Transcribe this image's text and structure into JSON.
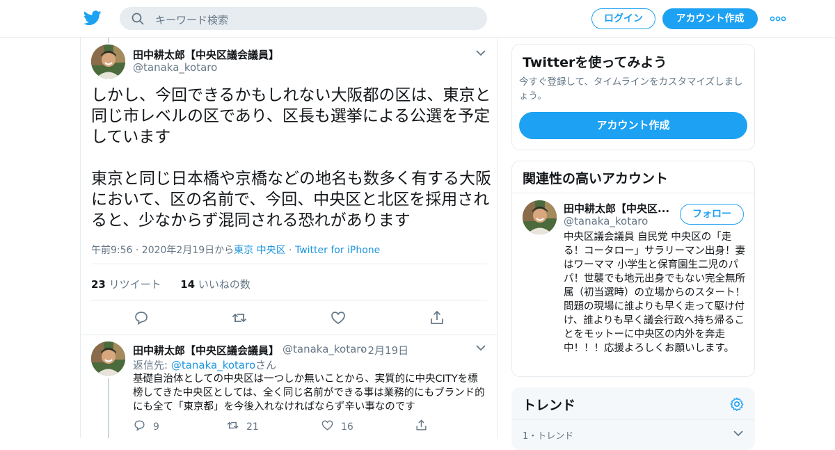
{
  "header": {
    "search_placeholder": "キーワード検索",
    "login_label": "ログイン",
    "signup_label": "アカウント作成",
    "brand_color": "#1da1f2"
  },
  "main_tweet": {
    "author_name": "田中耕太郎【中央区議会議員】",
    "author_handle": "@tanaka_kotaro",
    "text": "しかし、今回できるかもしれない大阪都の区は、東京と同じ市レベルの区であり、区長も選挙による公選を予定しています\n\n東京と同じ日本橋や京橋などの地名も数多く有する大阪において、区の名前で、今回、中央区と北区を採用されると、少なからず混同される恐れがあります",
    "time_date": "午前9:56 · 2020年2月19日から",
    "location": "東京 中央区",
    "meta_sep": " · ",
    "source": "Twitter for iPhone",
    "retweet_count": "23",
    "retweet_label": "リツイート",
    "like_count": "14",
    "like_label": "いいねの数"
  },
  "reply_tweet": {
    "author_name": "田中耕太郎【中央区議会議員】",
    "author_handle": "@tanaka_kotaro",
    "date": "· 2月19日",
    "reply_to_prefix": "返信先: ",
    "reply_to_handle": "@tanaka_kotaro",
    "reply_to_suffix": "さん",
    "text": "基礎自治体としての中央区は一つしか無いことから、実質的に中央CITYを標榜してきた中央区としては、全く同じ名前ができる事は業務的にもブランド的にも全て「東京都」を今後入れなければならず辛い事なのです",
    "reply_count": "9",
    "retweet_count": "21",
    "like_count": "16"
  },
  "sidebar": {
    "signup_card": {
      "title": "Twitterを使ってみよう",
      "description": "今すぐ登録して、タイムラインをカスタマイズしましょう。",
      "button_label": "アカウント作成"
    },
    "related_card": {
      "title": "関連性の高いアカウント",
      "name": "田中耕太郎【中央区...",
      "handle": "@tanaka_kotaro",
      "follow_label": "フォロー",
      "bio": "中央区議会議員 自民党 中央区の「走る！コータロー」サラリーマン出身！妻はワーママ 小学生と保育園生二児のパパ！世襲でも地元出身でもない完全無所属（初当選時）の立場からのスタート！問題の現場に誰よりも早く走って駆け付け、誰よりも早く議会行政へ持ち帰ることをモットーに中央区の内外を奔走中！！！応援よろしくお願いします。"
    },
    "trends_card": {
      "title": "トレンド",
      "first_item": "1・トレンド"
    }
  }
}
